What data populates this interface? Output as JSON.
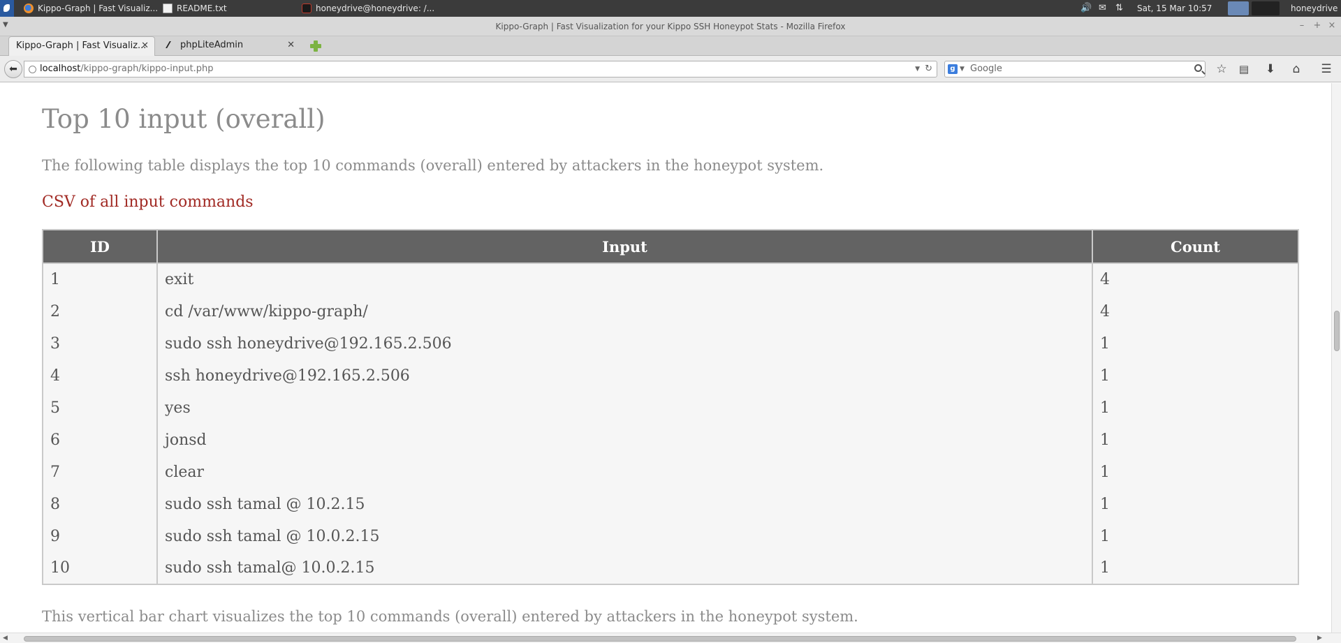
{
  "panel": {
    "tasks": [
      {
        "label": "Kippo-Graph | Fast Visualiz...",
        "icon": "firefox-icon"
      },
      {
        "label": "README.txt",
        "icon": "text-editor-icon"
      },
      {
        "label": "honeydrive@honeydrive: /...",
        "icon": "terminal-icon"
      }
    ],
    "clock": "Sat, 15 Mar  10:57",
    "user": "honeydrive"
  },
  "window": {
    "title": "Kippo-Graph | Fast Visualization for your Kippo SSH Honeypot Stats - Mozilla Firefox"
  },
  "tabs": [
    {
      "label": "Kippo-Graph | Fast Visualiz...",
      "active": true
    },
    {
      "label": "phpLiteAdmin",
      "active": false
    }
  ],
  "navbar": {
    "url_host": "localhost",
    "url_path": "/kippo-graph/kippo-input.php",
    "search_placeholder": "Google"
  },
  "page": {
    "heading": "Top 10 input (overall)",
    "description": "The following table displays the top 10 commands (overall) entered by attackers in the honeypot system.",
    "csv_link": "CSV of all input commands",
    "table": {
      "headers": [
        "ID",
        "Input",
        "Count"
      ],
      "rows": [
        {
          "id": "1",
          "input": "exit",
          "count": "4"
        },
        {
          "id": "2",
          "input": "cd /var/www/kippo-graph/",
          "count": "4"
        },
        {
          "id": "3",
          "input": "sudo ssh honeydrive@192.165.2.506",
          "count": "1"
        },
        {
          "id": "4",
          "input": "ssh honeydrive@192.165.2.506",
          "count": "1"
        },
        {
          "id": "5",
          "input": "yes",
          "count": "1"
        },
        {
          "id": "6",
          "input": "jonsd",
          "count": "1"
        },
        {
          "id": "7",
          "input": "clear",
          "count": "1"
        },
        {
          "id": "8",
          "input": "sudo ssh tamal @ 10.2.15",
          "count": "1"
        },
        {
          "id": "9",
          "input": "sudo ssh tamal @ 10.0.2.15",
          "count": "1"
        },
        {
          "id": "10",
          "input": "sudo ssh tamal@ 10.0.2.15",
          "count": "1"
        }
      ]
    },
    "chart_description": "This vertical bar chart visualizes the top 10 commands (overall) entered by attackers in the honeypot system."
  }
}
